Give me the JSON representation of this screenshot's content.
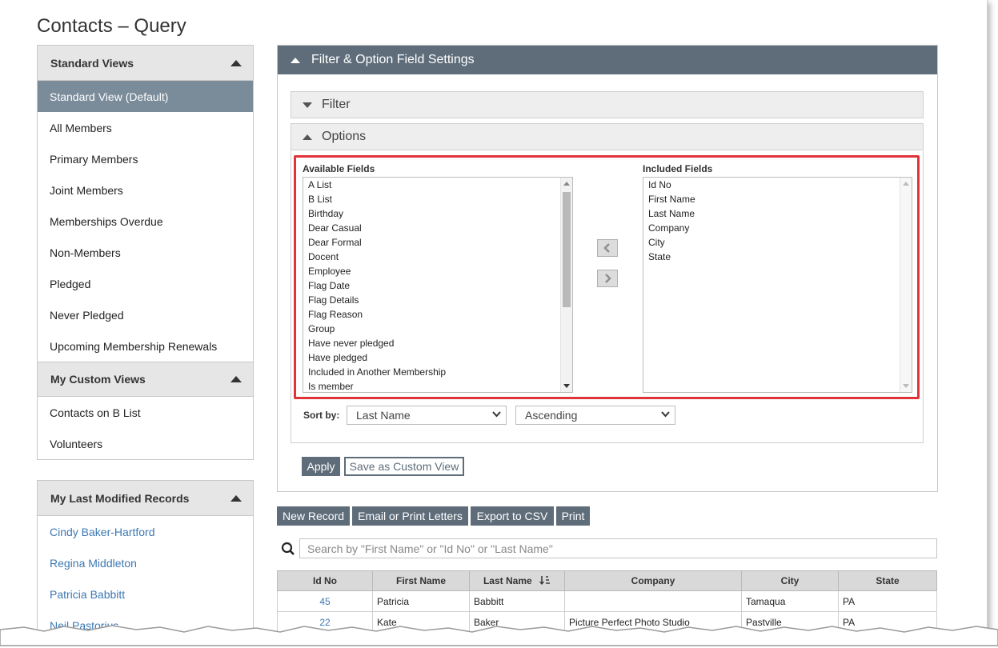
{
  "page": {
    "title": "Contacts – Query"
  },
  "standard_views": {
    "header": "Standard Views",
    "items": [
      "Standard View (Default)",
      "All Members",
      "Primary Members",
      "Joint Members",
      "Memberships Overdue",
      "Non-Members",
      "Pledged",
      "Never Pledged",
      "Upcoming Membership Renewals"
    ]
  },
  "custom_views": {
    "header": "My Custom Views",
    "items": [
      "Contacts on B List",
      "Volunteers"
    ]
  },
  "last_modified": {
    "header": "My Last Modified Records",
    "items": [
      "Cindy Baker-Hartford",
      "Regina Middleton",
      "Patricia Babbitt",
      "Neil Pastorius"
    ]
  },
  "settings": {
    "header": "Filter & Option Field Settings",
    "filter_label": "Filter",
    "options_label": "Options",
    "available_label": "Available Fields",
    "included_label": "Included Fields",
    "available_fields": [
      "A List",
      "B List",
      "Birthday",
      "Dear Casual",
      "Dear Formal",
      "Docent",
      "Employee",
      "Flag Date",
      "Flag Details",
      "Flag Reason",
      "Group",
      "Have never pledged",
      "Have pledged",
      "Included in Another Membership",
      "Is member"
    ],
    "included_fields": [
      "Id No",
      "First Name",
      "Last Name",
      "Company",
      "City",
      "State"
    ],
    "sort_label": "Sort by:",
    "sort_field": "Last Name",
    "sort_order": "Ascending",
    "apply_label": "Apply",
    "save_custom_label": "Save as Custom View"
  },
  "toolbar": {
    "new_record": "New Record",
    "email_print": "Email or Print Letters",
    "export_csv": "Export to CSV",
    "print": "Print"
  },
  "search": {
    "placeholder": "Search by \"First Name\" or \"Id No\" or \"Last Name\""
  },
  "table": {
    "columns": [
      "Id No",
      "First Name",
      "Last Name",
      "Company",
      "City",
      "State"
    ],
    "rows": [
      {
        "id": "45",
        "first": "Patricia",
        "last": "Babbitt",
        "company": "",
        "city": "Tamaqua",
        "state": "PA"
      },
      {
        "id": "22",
        "first": "Kate",
        "last": "Baker",
        "company": "Picture Perfect Photo Studio",
        "city": "Pastville",
        "state": "PA"
      }
    ]
  },
  "colors": {
    "accent_dark": "#5f6d7a",
    "active_view": "#7a8b9a",
    "link": "#3d78b3",
    "highlight": "#e0343a"
  }
}
